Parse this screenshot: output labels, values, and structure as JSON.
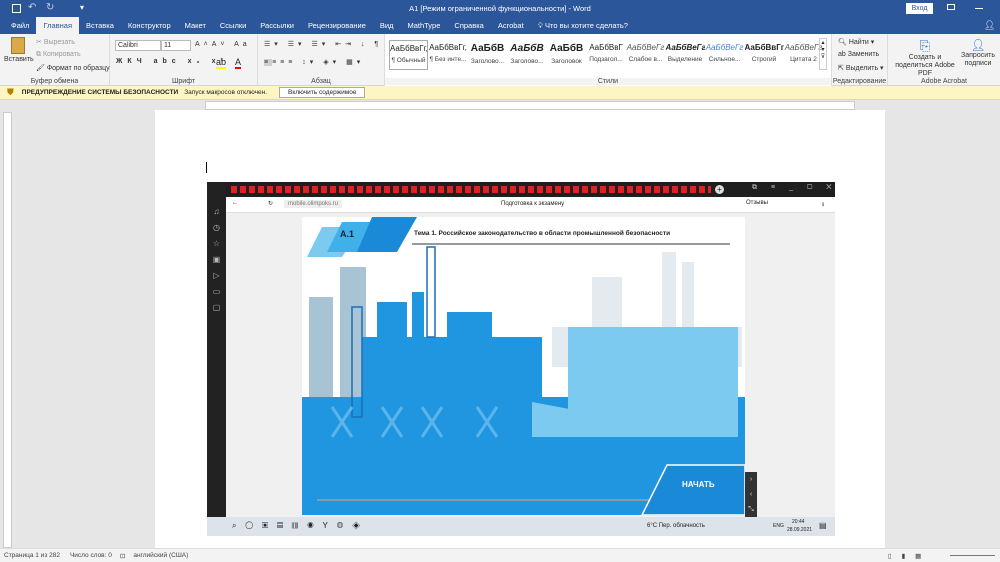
{
  "titlebar": {
    "title": "А1 [Режим ограниченной функциональности] - Word",
    "signin": "Вход"
  },
  "tabs": [
    "Файл",
    "Главная",
    "Вставка",
    "Конструктор",
    "Макет",
    "Ссылки",
    "Рассылки",
    "Рецензирование",
    "Вид",
    "MathType",
    "Справка",
    "Acrobat"
  ],
  "tell_me": "Что вы хотите сделать?",
  "clipboard": {
    "paste": "Вставить",
    "cut": "Вырезать",
    "copy": "Копировать",
    "format_painter": "Формат по образцу",
    "label": "Буфер обмена"
  },
  "font": {
    "name": "Calibri",
    "size": "11",
    "label": "Шрифт"
  },
  "paragraph": {
    "label": "Абзац"
  },
  "styles": {
    "label": "Стили",
    "items": [
      {
        "sample": "АаБбВвГг,",
        "name": "¶ Обычный"
      },
      {
        "sample": "АаБбВвГг,",
        "name": "¶ Без инте..."
      },
      {
        "sample": "АаБбВ",
        "name": "Заголово..."
      },
      {
        "sample": "АаБбВ",
        "name": "Заголово..."
      },
      {
        "sample": "АаБбВ",
        "name": "Заголовок"
      },
      {
        "sample": "АаБбВвГ",
        "name": "Подзагол..."
      },
      {
        "sample": "АаБбВеГг",
        "name": "Слабое в..."
      },
      {
        "sample": "АаБбВеГг",
        "name": "Выделение"
      },
      {
        "sample": "АаБбВеГг",
        "name": "Сильное..."
      },
      {
        "sample": "АаБбВвГг,",
        "name": "Строгий"
      },
      {
        "sample": "АаБбВеГг",
        "name": "Цитата 2"
      }
    ]
  },
  "editing": {
    "find": "Найти",
    "replace": "Заменить",
    "select": "Выделить",
    "label": "Редактирование"
  },
  "acrobat": {
    "create": "Создать и поделиться Adobe PDF",
    "request": "Запросить подписи",
    "label": "Adobe Acrobat"
  },
  "warning": {
    "title": "ПРЕДУПРЕЖДЕНИЕ СИСТЕМЫ БЕЗОПАСНОСТИ",
    "text": "Запуск макросов отключен.",
    "button": "Включить содержимое"
  },
  "embedded": {
    "url": "mobile.olimpoks.ru",
    "page_title": "Подготовка к экзамену",
    "reviews": "Отзывы",
    "slide_code": "А.1",
    "slide_title": "Тема 1. Российское законодательство в области промышленной безопасности",
    "start": "НАЧАТЬ",
    "weather": "6°C  Пер. облачность",
    "lang": "ENG",
    "time": "20:44",
    "date": "28.09.2021"
  },
  "status": {
    "page": "Страница 1 из 282",
    "words": "Число слов: 0",
    "language": "английский (США)"
  },
  "colors": {
    "word_blue": "#2b579a",
    "slide_blue": "#2196e0",
    "light_blue": "#7ccaf0"
  }
}
